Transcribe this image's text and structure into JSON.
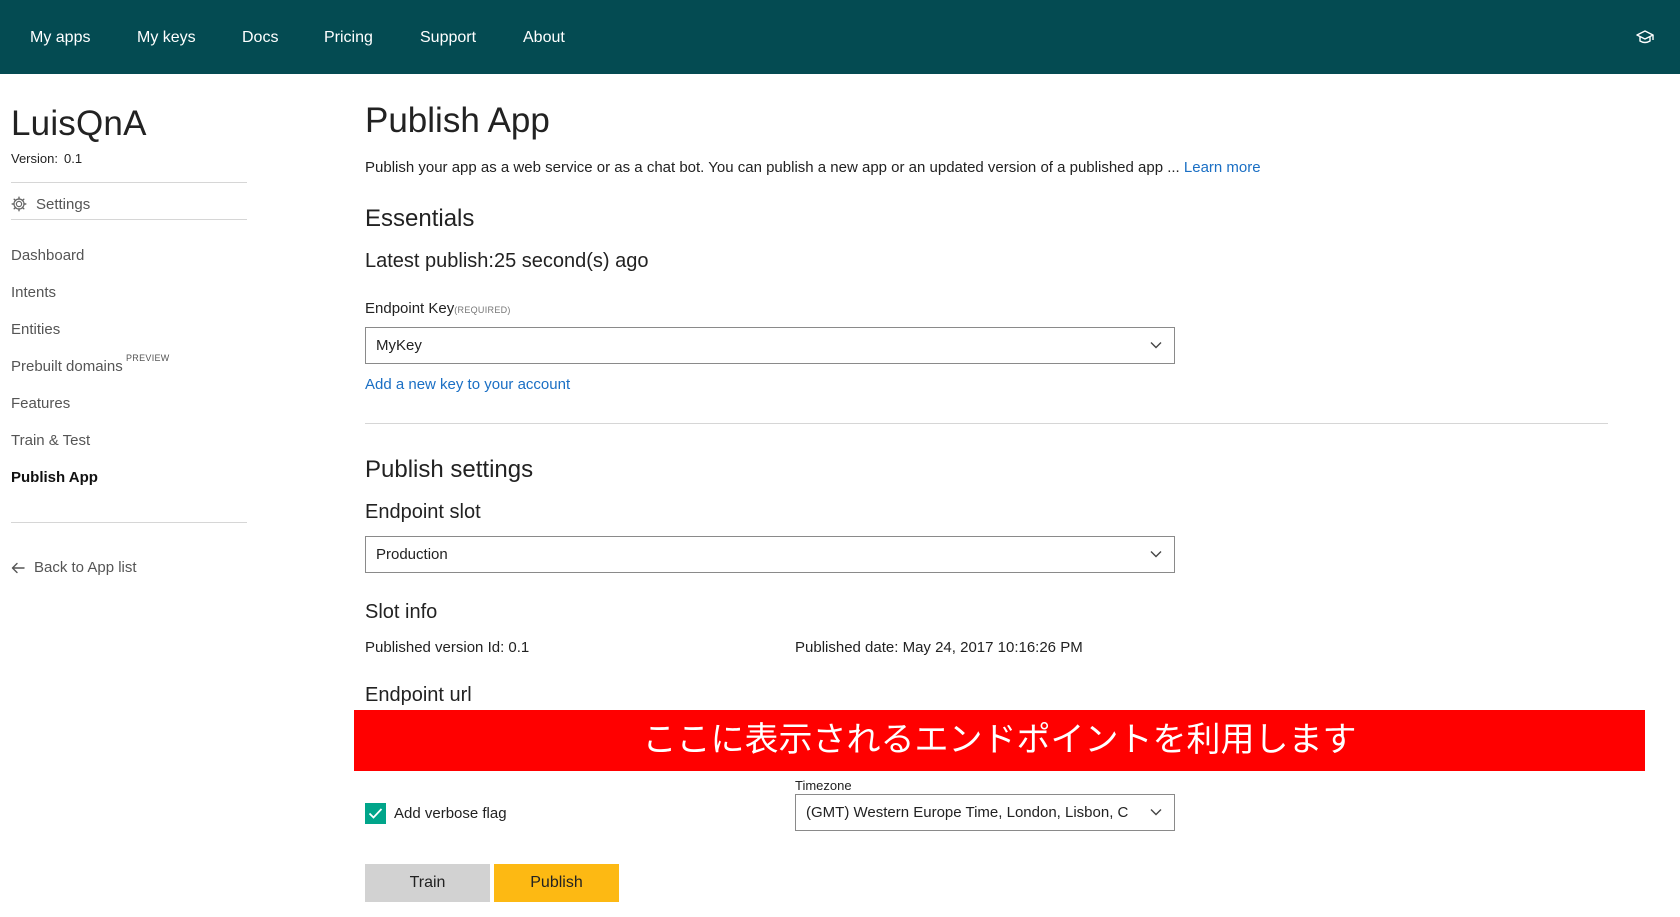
{
  "nav": {
    "items": [
      "My apps",
      "My keys",
      "Docs",
      "Pricing",
      "Support",
      "About"
    ]
  },
  "sidebar": {
    "app_name": "LuisQnA",
    "version_label": "Version:",
    "version": "0.1",
    "settings_label": "Settings",
    "items": [
      {
        "label": "Dashboard"
      },
      {
        "label": "Intents"
      },
      {
        "label": "Entities"
      },
      {
        "label": "Prebuilt domains"
      },
      {
        "label": "Features"
      },
      {
        "label": "Train & Test"
      },
      {
        "label": "Publish App"
      }
    ],
    "preview_badge": "PREVIEW",
    "back_label": "Back to App list"
  },
  "main": {
    "title": "Publish App",
    "description": "Publish your app as a web service or as a chat bot. You can publish a new app or an updated version of a published app ... ",
    "learn_more": "Learn more",
    "essentials_heading": "Essentials",
    "latest_publish": "Latest publish:25 second(s) ago",
    "endpoint_key_label": "Endpoint Key",
    "endpoint_key_required": "(REQUIRED)",
    "endpoint_key_value": "MyKey",
    "add_key_link": "Add a new key to your account",
    "publish_settings_heading": "Publish settings",
    "endpoint_slot_heading": "Endpoint slot",
    "endpoint_slot_value": "Production",
    "slot_info_heading": "Slot info",
    "published_version": "Published version Id: 0.1",
    "published_date": "Published date: May 24, 2017 10:16:26 PM",
    "endpoint_url_heading": "Endpoint url",
    "banner_text": "ここに表示されるエンドポイントを利用します",
    "verbose_label": "Add verbose flag",
    "verbose_checked": true,
    "timezone_label": "Timezone",
    "timezone_value": "(GMT) Western Europe Time, London, Lisbon, C",
    "train_button": "Train",
    "publish_button": "Publish"
  },
  "colors": {
    "topbar": "#044b52",
    "link": "#1a6fc4",
    "banner": "#ff0000",
    "checkbox": "#00a58a",
    "publish_button": "#fdb913",
    "train_button": "#d2d2d2"
  }
}
